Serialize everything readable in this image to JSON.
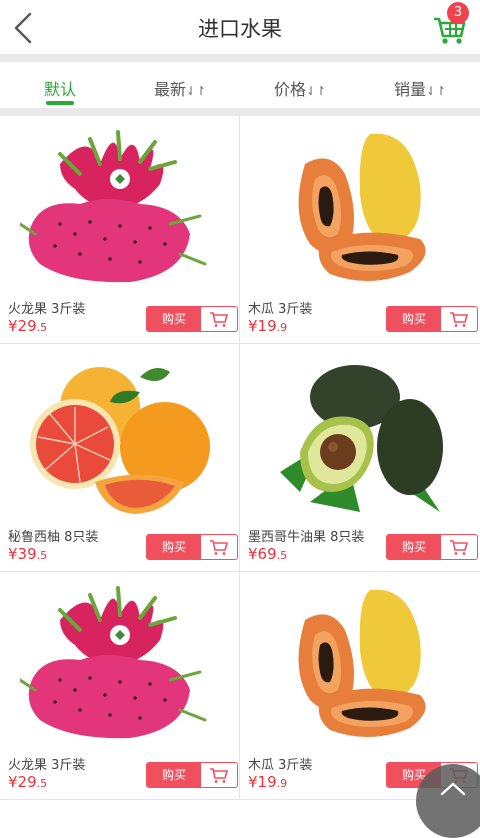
{
  "header": {
    "title": "进口水果",
    "cart_count": "3"
  },
  "colors": {
    "accent": "#2aa838",
    "price": "#e8323d",
    "buy": "#f0505e"
  },
  "tabs": [
    {
      "label": "默认",
      "sort_icon": ""
    },
    {
      "label": "最新",
      "sort_icon": "⇃↾"
    },
    {
      "label": "价格",
      "sort_icon": "⇃↾"
    },
    {
      "label": "销量",
      "sort_icon": "⇃↾"
    }
  ],
  "products": [
    {
      "name": "火龙果 3斤装",
      "currency": "¥",
      "price_int": "29",
      "price_dec": ".5",
      "buy_label": "购买",
      "image": "dragon-fruit"
    },
    {
      "name": "木瓜 3斤装",
      "currency": "¥",
      "price_int": "19",
      "price_dec": ".9",
      "buy_label": "购买",
      "image": "papaya"
    },
    {
      "name": "秘鲁西柚 8只装",
      "currency": "¥",
      "price_int": "39",
      "price_dec": ".5",
      "buy_label": "购买",
      "image": "grapefruit"
    },
    {
      "name": "墨西哥牛油果 8只装",
      "currency": "¥",
      "price_int": "69",
      "price_dec": ".5",
      "buy_label": "购买",
      "image": "avocado"
    },
    {
      "name": "火龙果 3斤装",
      "currency": "¥",
      "price_int": "29",
      "price_dec": ".5",
      "buy_label": "购买",
      "image": "dragon-fruit"
    },
    {
      "name": "木瓜 3斤装",
      "currency": "¥",
      "price_int": "19",
      "price_dec": ".9",
      "buy_label": "购买",
      "image": "papaya"
    }
  ]
}
